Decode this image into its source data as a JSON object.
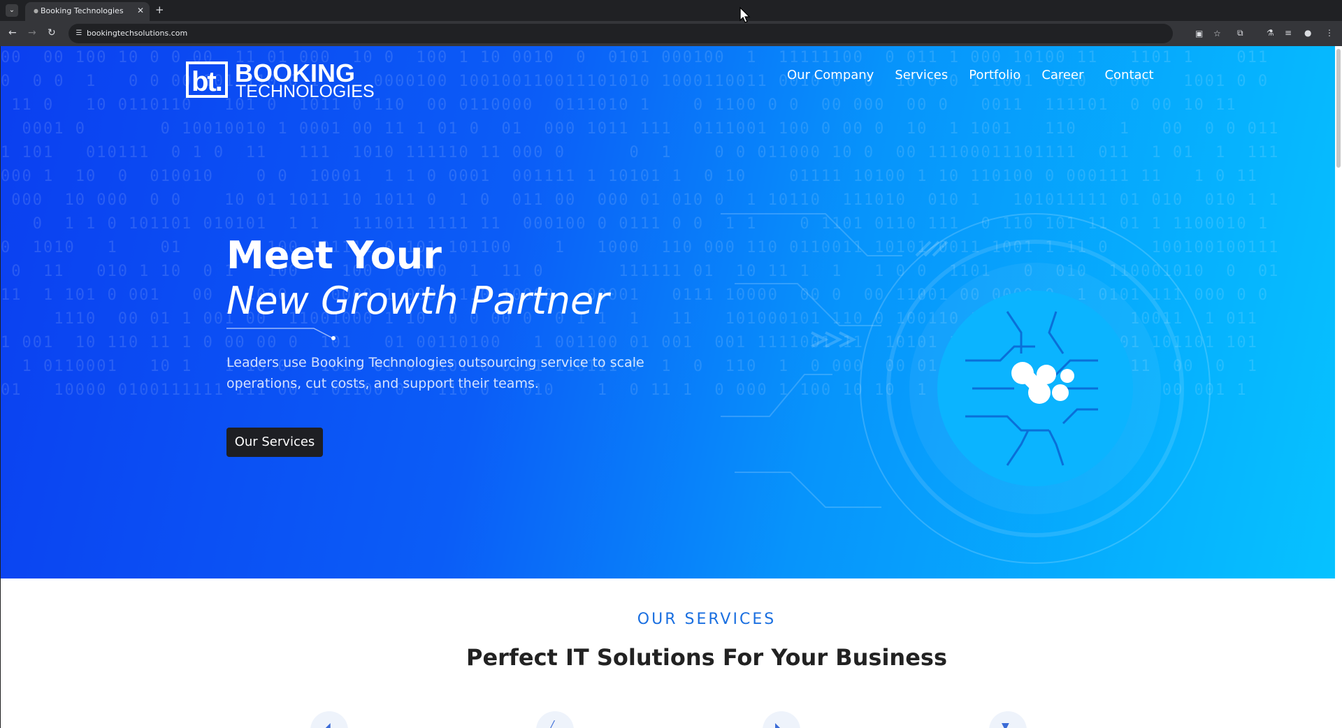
{
  "browser": {
    "tab_title": "Booking Technologies",
    "url": "bookingtechsolutions.com"
  },
  "site": {
    "logo": {
      "mark": "bt.",
      "word1": "BOOKING",
      "word2": "TECHNOLOGIES"
    },
    "nav": [
      "Our Company",
      "Services",
      "Portfolio",
      "Career",
      "Contact"
    ],
    "hero": {
      "title_line1": "Meet Your",
      "title_line2": "New Growth Partner",
      "lead": "Leaders use Booking Technologies outsourcing service to scale operations, cut costs, and support their teams.",
      "cta_label": "Our Services"
    },
    "services_section": {
      "eyebrow": "OUR SERVICES",
      "title": "Perfect IT Solutions For Your Business"
    }
  },
  "colors": {
    "hero_start": "#0b3ff0",
    "hero_end": "#06c2ff",
    "cta_bg": "#1e1f23",
    "eyebrow": "#1a6fe0"
  },
  "icons": [
    "tab-list-icon",
    "site-favicon",
    "close-icon",
    "new-tab-icon",
    "back-icon",
    "forward-icon",
    "reload-icon",
    "site-info-icon",
    "install-app-icon",
    "bookmark-star-icon",
    "extensions-icon",
    "labs-icon",
    "media-controls-icon",
    "profile-icon",
    "menu-icon",
    "circuit-chip-icon",
    "mouse-cursor-icon"
  ]
}
